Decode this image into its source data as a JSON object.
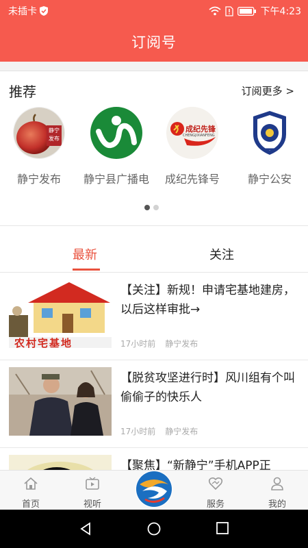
{
  "status_bar": {
    "carrier": "未插卡",
    "time": "下午4:23",
    "icons": [
      "shield-icon",
      "wifi-icon",
      "sim-alert-icon",
      "battery-icon"
    ]
  },
  "header": {
    "title": "订阅号",
    "bg_color": "#f65a4e"
  },
  "recommend": {
    "heading": "推荐",
    "more": "订阅更多 >",
    "accounts": [
      {
        "label": "静宁发布",
        "icon": "apple-logo-icon"
      },
      {
        "label": "静宁县广播电",
        "icon": "broadcast-logo-icon"
      },
      {
        "label": "成纪先锋号",
        "icon": "party-logo-icon",
        "logo_text": "成纪先锋",
        "logo_sub": "CHENGJIXIANFENG"
      },
      {
        "label": "静宁公安",
        "icon": "police-badge-icon"
      }
    ],
    "apple_badge_text": "静宁发布",
    "page_indicator": {
      "count": 2,
      "active": 0
    }
  },
  "tabs": [
    {
      "label": "最新",
      "active": true
    },
    {
      "label": "关注",
      "active": false
    }
  ],
  "accent_color": "#e9513d",
  "feed": [
    {
      "title": "【关注】新规！申请宅基地建房，以后这样审批→",
      "time": "17小时前",
      "source": "静宁发布",
      "thumb_caption": "农村宅基地"
    },
    {
      "title": "【脱贫攻坚进行时】风川组有个叫偷偷子的快乐人",
      "time": "17小时前",
      "source": "静宁发布"
    },
    {
      "title": "【聚焦】“新静宁”手机APP正"
    }
  ],
  "tabbar": [
    {
      "label": "首页",
      "icon": "home-icon"
    },
    {
      "label": "视听",
      "icon": "video-icon"
    },
    {
      "label": "",
      "icon": "app-logo-icon"
    },
    {
      "label": "服务",
      "icon": "service-icon"
    },
    {
      "label": "我的",
      "icon": "user-icon"
    }
  ],
  "navbar": {
    "icons": [
      "back-icon",
      "home-circle-icon",
      "recents-icon"
    ]
  }
}
